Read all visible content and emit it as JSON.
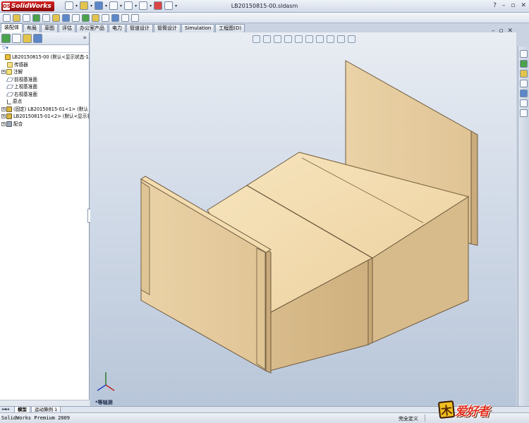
{
  "app": {
    "brand": "SolidWorks",
    "file_title": "LB20150815-00.sldasm"
  },
  "ribbon_tabs": [
    "装配体",
    "布局",
    "草图",
    "评估",
    "办公室产品",
    "电力",
    "管道设计",
    "管筒设计",
    "Simulation",
    "工程图(D)"
  ],
  "feature_tree": {
    "items": [
      {
        "label": "LB20150815-00  (默认<显示状态-1>",
        "icon": "assembly-icon",
        "toggle": ""
      },
      {
        "label": "传感器",
        "icon": "sensor-icon",
        "toggle": ""
      },
      {
        "label": "注解",
        "icon": "annotation-icon",
        "toggle": "+"
      },
      {
        "label": "前视基准面",
        "icon": "plane-icon",
        "toggle": ""
      },
      {
        "label": "上视基准面",
        "icon": "plane-icon",
        "toggle": ""
      },
      {
        "label": "右视基准面",
        "icon": "plane-icon",
        "toggle": ""
      },
      {
        "label": "原点",
        "icon": "origin-icon",
        "toggle": ""
      },
      {
        "label": "(固定) LB20150815-01<1> (默认",
        "icon": "part-icon",
        "toggle": "+"
      },
      {
        "label": "LB20150815-01<2> (默认<显示状",
        "icon": "part-icon",
        "toggle": "+"
      },
      {
        "label": "配合",
        "icon": "mates-icon",
        "toggle": "+"
      }
    ]
  },
  "viewport": {
    "view_label": "*等轴测"
  },
  "bottom_tabs": [
    "模型",
    "运动算例 1"
  ],
  "status": {
    "left": "SolidWorks Premium 2009",
    "right": "完全定义"
  },
  "watermark": {
    "mark": "木",
    "text": "爱好者"
  },
  "colors": {
    "wood_light": "#f3ddb0",
    "wood_mid": "#e3c796",
    "wood_dark": "#c7a87a",
    "brand_red": "#c01818"
  }
}
